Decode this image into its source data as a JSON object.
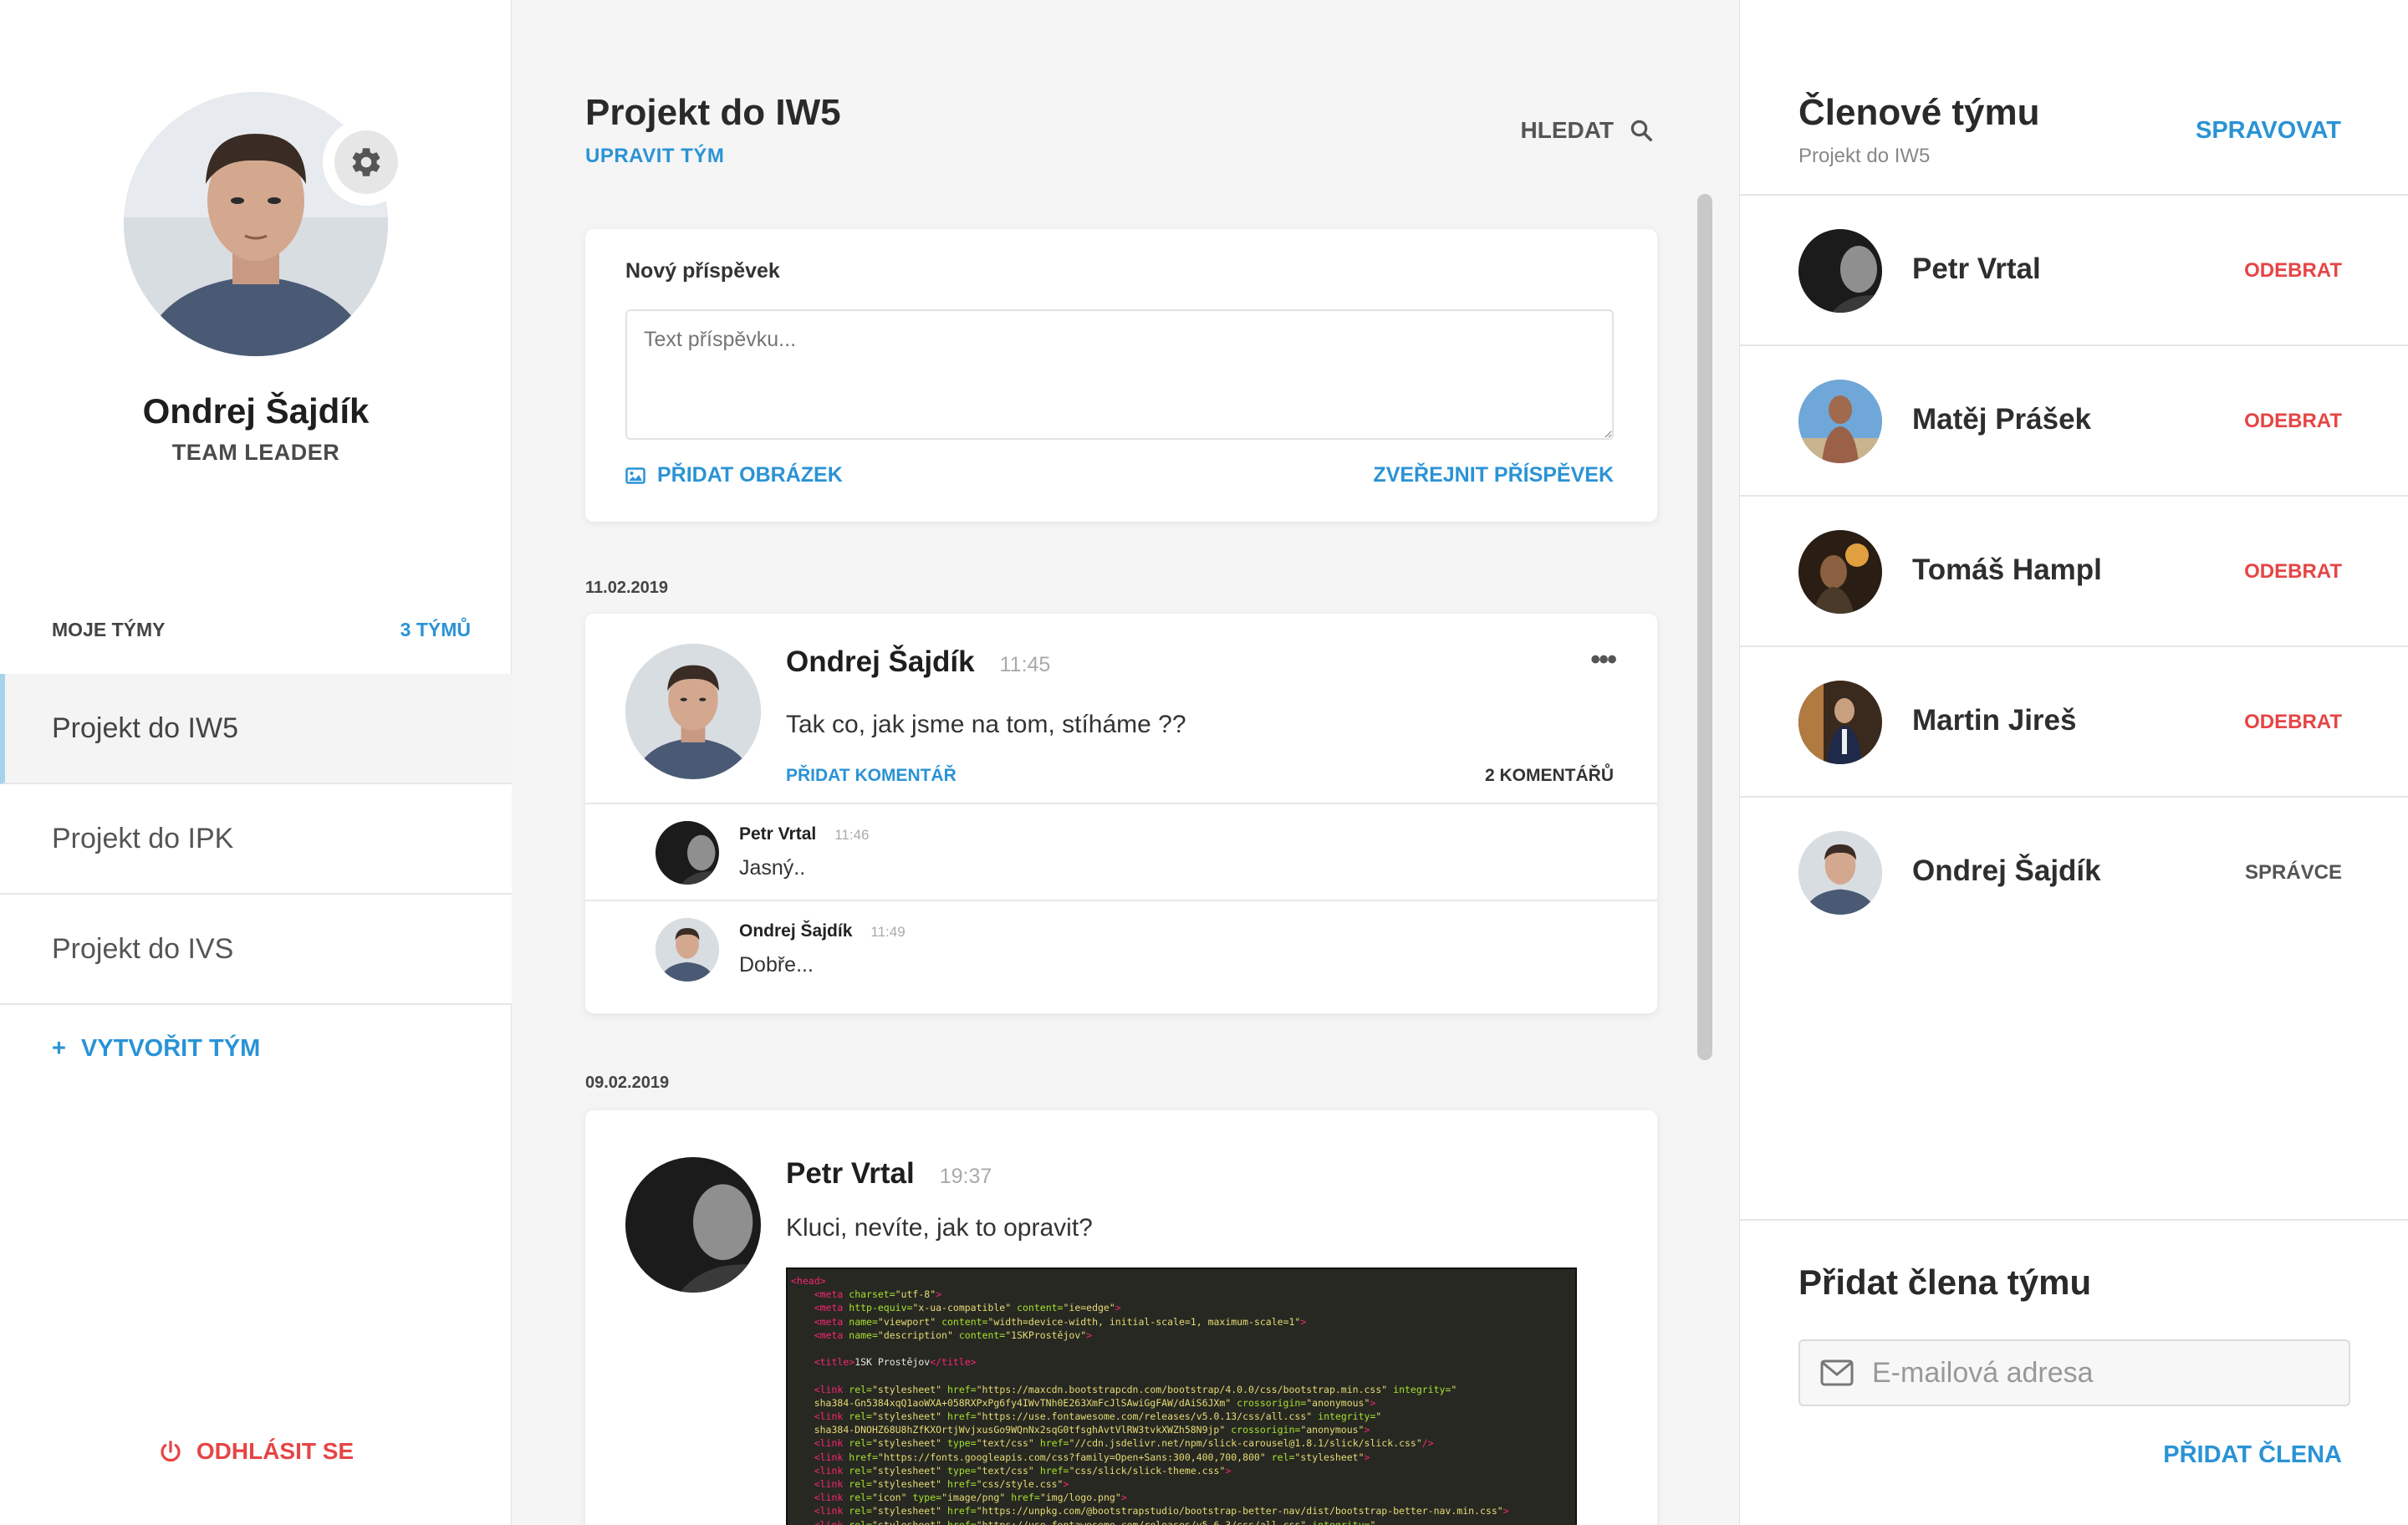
{
  "user": {
    "name": "Ondrej Šajdík",
    "role": "TEAM LEADER"
  },
  "teams": {
    "label": "MOJE TÝMY",
    "count": "3 TÝMŮ",
    "items": [
      {
        "label": "Projekt do IW5",
        "active": true
      },
      {
        "label": "Projekt do IPK",
        "active": false
      },
      {
        "label": "Projekt do IVS",
        "active": false
      }
    ],
    "create_label": "VYTVOŘIT TÝM",
    "create_plus": "+"
  },
  "logout_label": "ODHLÁSIT SE",
  "header": {
    "title": "Projekt do IW5",
    "edit_label": "UPRAVIT TÝM",
    "search_label": "HLEDAT"
  },
  "new_post": {
    "title": "Nový příspěvek",
    "placeholder": "Text příspěvku...",
    "add_image_label": "PŘIDAT OBRÁZEK",
    "publish_label": "ZVEŘEJNIT PŘÍSPĚVEK"
  },
  "posts": [
    {
      "date": "11.02.2019",
      "author": "Ondrej Šajdík",
      "time": "11:45",
      "menu": "•••",
      "text": "Tak co, jak jsme na tom, stíháme ??",
      "add_comment_label": "PŘIDAT KOMENTÁŘ",
      "comment_count_label": "2 KOMENTÁŘŮ",
      "comments": [
        {
          "author": "Petr Vrtal",
          "time": "11:46",
          "text": "Jasný.."
        },
        {
          "author": "Ondrej Šajdík",
          "time": "11:49",
          "text": "Dobře..."
        }
      ]
    },
    {
      "date": "09.02.2019",
      "author": "Petr Vrtal",
      "time": "19:37",
      "text": "Kluci, nevíte, jak to opravit?",
      "image_alt": "code-screenshot"
    }
  ],
  "members": {
    "title": "Členové týmu",
    "subtitle": "Projekt do IW5",
    "manage_label": "SPRAVOVAT",
    "items": [
      {
        "name": "Petr Vrtal",
        "action": "ODEBRAT"
      },
      {
        "name": "Matěj Prášek",
        "action": "ODEBRAT"
      },
      {
        "name": "Tomáš Hampl",
        "action": "ODEBRAT"
      },
      {
        "name": "Martin Jireš",
        "action": "ODEBRAT"
      },
      {
        "name": "Ondrej Šajdík",
        "action": "SPRÁVCE"
      }
    ]
  },
  "add_member": {
    "title": "Přidat člena týmu",
    "email_placeholder": "E-mailová adresa",
    "submit_label": "PŘIDAT ČLENA"
  },
  "colors": {
    "accent": "#2a93d5",
    "danger": "#e64545",
    "active_bar": "#a6d3ec"
  },
  "icons": {
    "settings": "gear-icon",
    "search": "search-icon",
    "image": "image-icon",
    "power": "power-icon",
    "mail": "envelope-icon",
    "menu": "more-dots-icon"
  }
}
